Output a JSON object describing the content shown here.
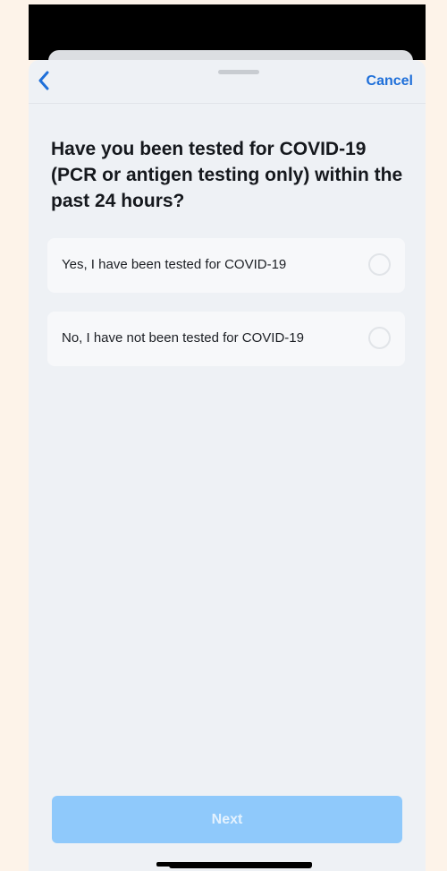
{
  "nav": {
    "back_icon": "chevron-left-icon",
    "cancel_label": "Cancel"
  },
  "question": {
    "text": "Have you been tested for COVID-19 (PCR or antigen testing only) within the past 24 hours?"
  },
  "options": [
    {
      "label": "Yes, I have been tested for COVID-19",
      "selected": false
    },
    {
      "label": "No, I have not been tested for COVID-19",
      "selected": false
    }
  ],
  "footer": {
    "next_label": "Next",
    "next_enabled": false
  },
  "colors": {
    "accent": "#1e6fd9",
    "background": "#fdf3e9",
    "sheet": "#eef1f5",
    "next_disabled": "#8fc9fb"
  }
}
